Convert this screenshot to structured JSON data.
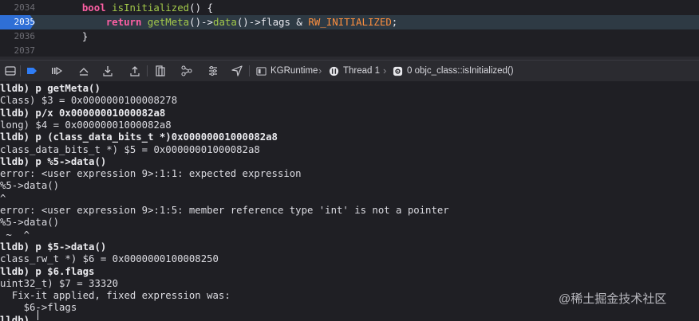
{
  "editor": {
    "lines": [
      {
        "num": "2034",
        "tokens": [
          [
            "    ",
            ""
          ],
          [
            "bool",
            "kw"
          ],
          [
            " ",
            ""
          ],
          [
            "isInitialized",
            "fn"
          ],
          [
            "() {",
            ""
          ]
        ]
      },
      {
        "num": "2035",
        "current": true,
        "tokens": [
          [
            "        ",
            ""
          ],
          [
            "return",
            "kw"
          ],
          [
            " ",
            ""
          ],
          [
            "getMeta",
            "fn"
          ],
          [
            "()->",
            ""
          ],
          [
            "data",
            "fn"
          ],
          [
            "()->flags & ",
            ""
          ],
          [
            "RW_INITIALIZED",
            "mc"
          ],
          [
            ";",
            ""
          ]
        ]
      },
      {
        "num": "2036",
        "tokens": [
          [
            "    }",
            ""
          ]
        ]
      },
      {
        "num": "2037",
        "tokens": []
      }
    ]
  },
  "toolbar": {
    "buttons": [
      "hide-console-icon",
      "breakpoint-toggle-icon",
      "continue-icon",
      "step-over-icon",
      "step-into-icon",
      "step-out-icon",
      "view-hierarchy-icon",
      "memory-graph-icon",
      "location-icon"
    ],
    "target": "KGRuntime",
    "thread": "Thread 1",
    "frame": "0 objc_class::isInitialized()"
  },
  "console": {
    "lines": [
      {
        "text": "lldb) p getMeta()",
        "type": "cmd"
      },
      {
        "text": "Class) $3 = 0x0000000100008278",
        "type": "out"
      },
      {
        "text": "lldb) p/x 0x00000001000082a8",
        "type": "cmd"
      },
      {
        "text": "long) $4 = 0x00000001000082a8",
        "type": "out"
      },
      {
        "text": "lldb) p (class_data_bits_t *)0x00000001000082a8",
        "type": "cmd"
      },
      {
        "text": "class_data_bits_t *) $5 = 0x00000001000082a8",
        "type": "out"
      },
      {
        "text": "lldb) p %5->data()",
        "type": "cmd"
      },
      {
        "text": "error: <user expression 9>:1:1: expected expression",
        "type": "out"
      },
      {
        "text": "%5->data()",
        "type": "out"
      },
      {
        "text": "^",
        "type": "out"
      },
      {
        "text": "error: <user expression 9>:1:5: member reference type 'int' is not a pointer",
        "type": "out"
      },
      {
        "text": "%5->data()",
        "type": "out"
      },
      {
        "text": " ~  ^",
        "type": "out"
      },
      {
        "text": "lldb) p $5->data()",
        "type": "cmd"
      },
      {
        "text": "class_rw_t *) $6 = 0x0000000100008250",
        "type": "out"
      },
      {
        "text": "lldb) p $6.flags",
        "type": "cmd"
      },
      {
        "text": "uint32_t) $7 = 33320",
        "type": "out"
      },
      {
        "text": "  Fix-it applied, fixed expression was:",
        "type": "out"
      },
      {
        "text": "    $6->flags",
        "type": "out"
      },
      {
        "text": "lldb)",
        "type": "cmd"
      }
    ]
  },
  "watermark": "@稀土掘金技术社区"
}
